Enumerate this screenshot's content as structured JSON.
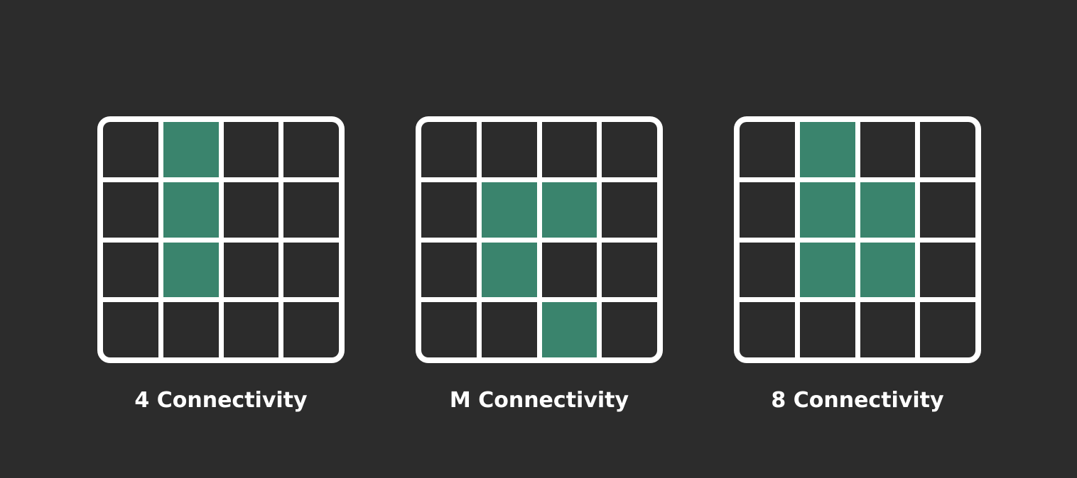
{
  "colors": {
    "background": "#2c2c2c",
    "grid_line": "#ffffff",
    "active_cell": "#3a846d"
  },
  "panels": [
    {
      "label": "4 Connectivity",
      "grid": [
        [
          0,
          1,
          0,
          0
        ],
        [
          0,
          1,
          0,
          0
        ],
        [
          0,
          1,
          0,
          0
        ],
        [
          0,
          0,
          0,
          0
        ]
      ]
    },
    {
      "label": "M Connectivity",
      "grid": [
        [
          0,
          0,
          0,
          0
        ],
        [
          0,
          1,
          1,
          0
        ],
        [
          0,
          1,
          0,
          0
        ],
        [
          0,
          0,
          1,
          0
        ]
      ]
    },
    {
      "label": "8 Connectivity",
      "grid": [
        [
          0,
          1,
          0,
          0
        ],
        [
          0,
          1,
          1,
          0
        ],
        [
          0,
          1,
          1,
          0
        ],
        [
          0,
          0,
          0,
          0
        ]
      ]
    }
  ]
}
